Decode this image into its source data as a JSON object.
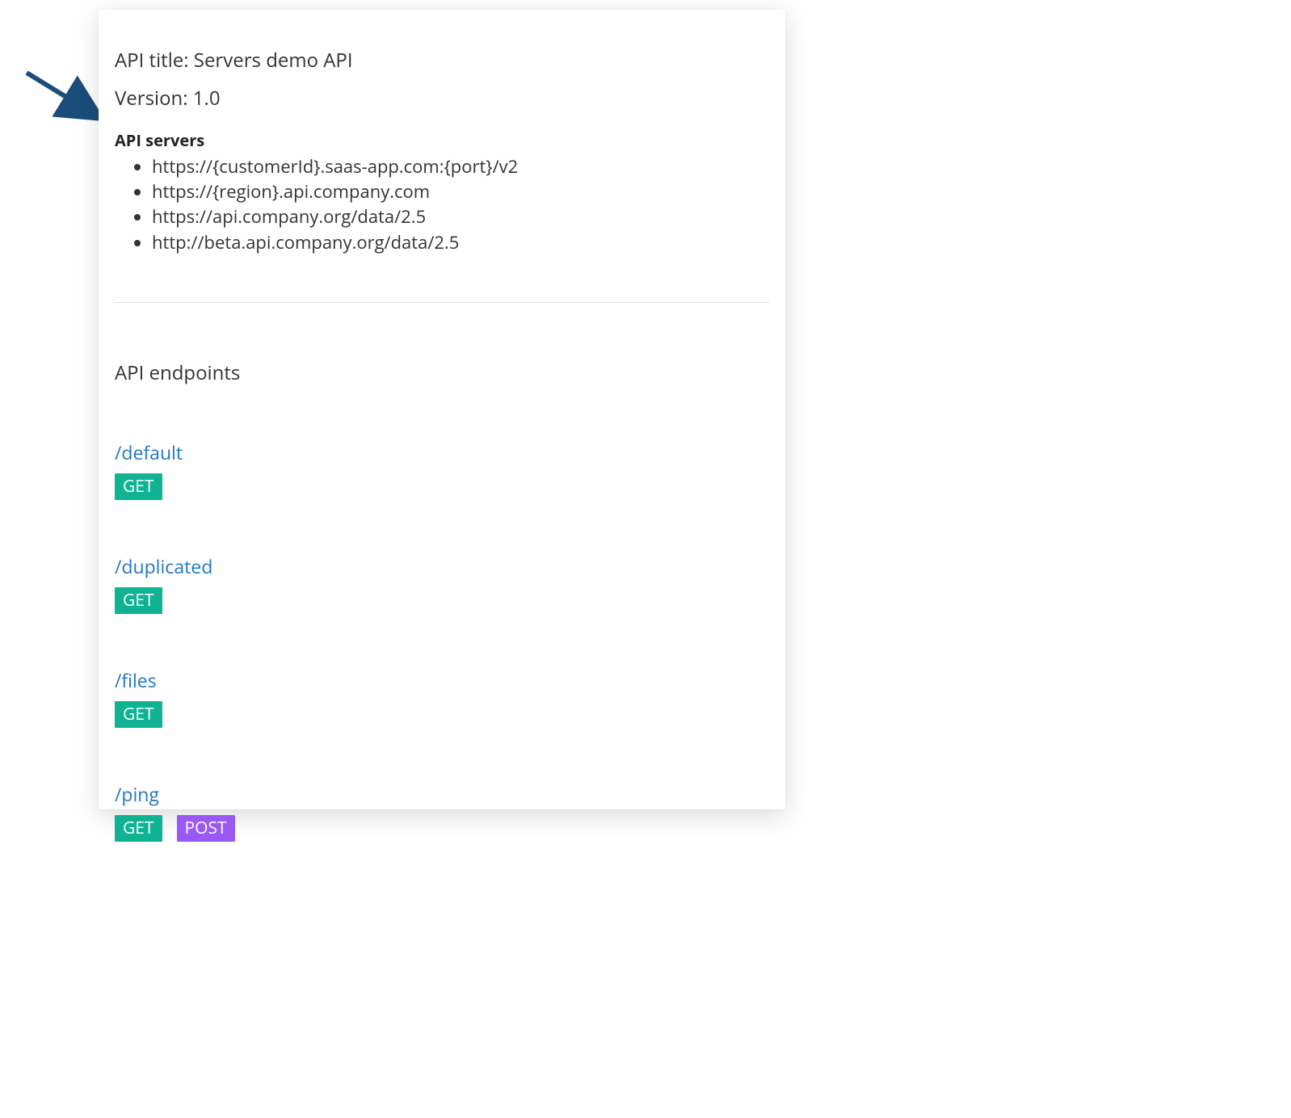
{
  "header": {
    "api_title_label": "API title:",
    "api_title_value": "Servers demo API",
    "version_label": "Version:",
    "version_value": "1.0",
    "servers_heading": "API servers"
  },
  "servers": [
    "https://{customerId}.saas-app.com:{port}/v2",
    "https://{region}.api.company.com",
    "https://api.company.org/data/2.5",
    "http://beta.api.company.org/data/2.5"
  ],
  "endpoints_heading": "API endpoints",
  "endpoints": [
    {
      "path": "/default",
      "methods": [
        "GET"
      ]
    },
    {
      "path": "/duplicated",
      "methods": [
        "GET"
      ]
    },
    {
      "path": "/files",
      "methods": [
        "GET"
      ]
    },
    {
      "path": "/ping",
      "methods": [
        "GET",
        "POST"
      ]
    }
  ],
  "colors": {
    "arrow": "#1b4d7a",
    "link": "#1f77c8",
    "get_bg": "#0fb394",
    "post_bg": "#9a59f5"
  }
}
